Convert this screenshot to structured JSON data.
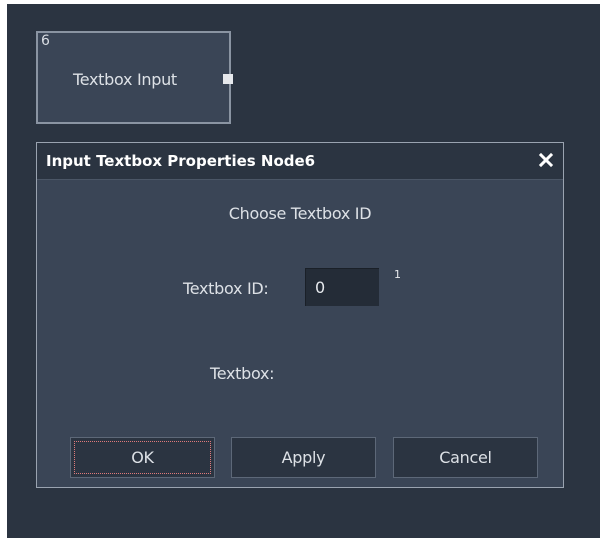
{
  "node": {
    "id": "6",
    "label": "Textbox Input",
    "port_icon": "output-port-square"
  },
  "dialog": {
    "title": "Input Textbox Properties Node6",
    "close_icon": "close-x",
    "heading": "Choose Textbox ID",
    "textbox_id_label": "Textbox ID:",
    "textbox_id_value": "0",
    "textbox_id_hint": "1",
    "textbox_label": "Textbox:",
    "buttons": {
      "ok": "OK",
      "apply": "Apply",
      "cancel": "Cancel"
    }
  },
  "colors": {
    "canvas": "#2b3441",
    "panel": "#3a4556",
    "text": "#dde1e6"
  }
}
